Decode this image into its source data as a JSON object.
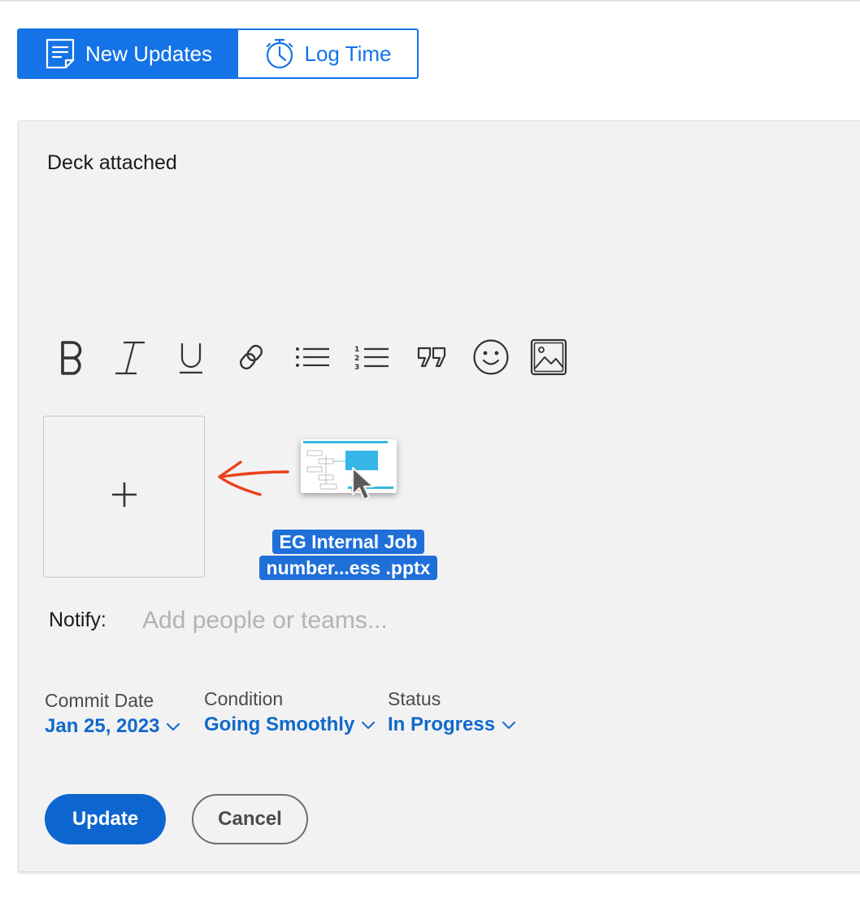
{
  "tabs": {
    "new_updates": {
      "label": "New Updates",
      "icon": "note-icon",
      "active": true
    },
    "log_time": {
      "label": "Log Time",
      "icon": "stopwatch-icon",
      "active": false
    }
  },
  "editor": {
    "text": "Deck attached"
  },
  "toolbar": {
    "tools": [
      "bold",
      "italic",
      "underline",
      "link",
      "bulleted-list",
      "numbered-list",
      "quote",
      "emoji",
      "image"
    ]
  },
  "attachment": {
    "add_symbol": "+",
    "file_name_line1": "EG Internal Job",
    "file_name_line2": "number...ess .pptx"
  },
  "notify": {
    "label": "Notify:",
    "placeholder": "Add people or teams..."
  },
  "fields": {
    "commit_date": {
      "label": "Commit Date",
      "value": "Jan 25, 2023"
    },
    "condition": {
      "label": "Condition",
      "value": "Going Smoothly"
    },
    "status": {
      "label": "Status",
      "value": "In Progress"
    }
  },
  "actions": {
    "update": "Update",
    "cancel": "Cancel"
  },
  "colors": {
    "accent": "#1473e6",
    "link_blue": "#1069cc",
    "card_bg": "#f2f2f2",
    "annotation_arrow": "#e8431c"
  }
}
